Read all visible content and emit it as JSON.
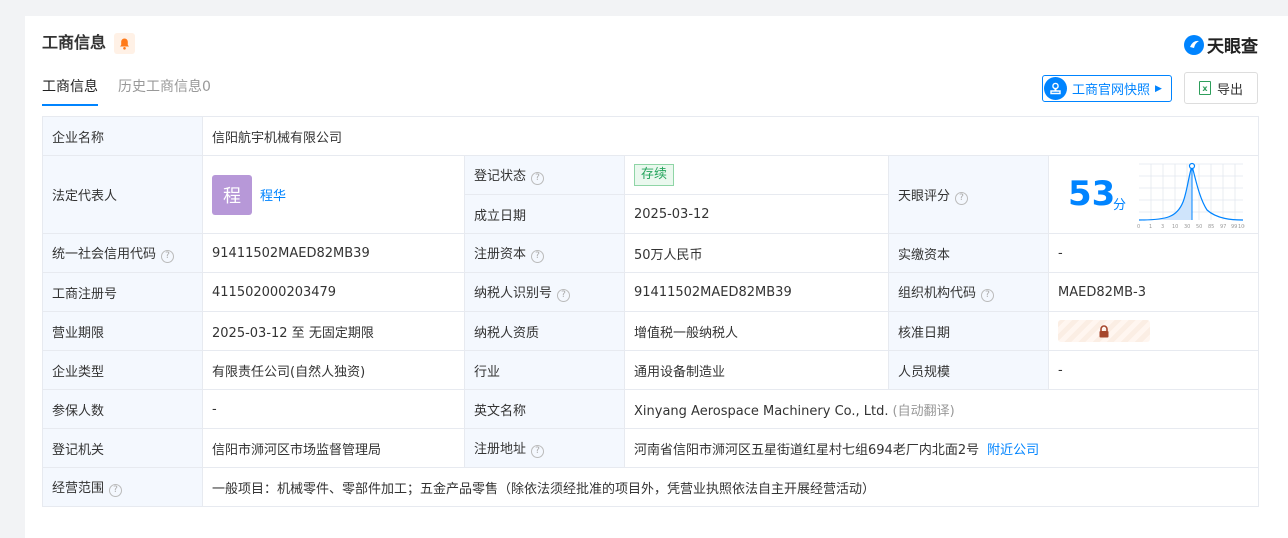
{
  "header": {
    "title": "工商信息",
    "brand": "天眼查"
  },
  "tabs": [
    {
      "label": "工商信息",
      "active": true
    },
    {
      "label": "历史工商信息0",
      "active": false
    }
  ],
  "toolbar": {
    "snapshot_label": "工商官网快照",
    "export_label": "导出"
  },
  "company": {
    "name_label": "企业名称",
    "name": "信阳航宇机械有限公司",
    "legal_rep_label": "法定代表人",
    "legal_rep_avatar": "程",
    "legal_rep": "程华",
    "reg_status_label": "登记状态",
    "reg_status": "存续",
    "founded_label": "成立日期",
    "founded": "2025-03-12",
    "tianyan_score_label": "天眼评分",
    "tianyan_score": "53",
    "score_unit": "分",
    "score_chart_ticks": [
      "0",
      "1",
      "3",
      "10",
      "30",
      "50",
      "85",
      "97",
      "99",
      "100"
    ],
    "credit_code_label": "统一社会信用代码",
    "credit_code": "91411502MAED82MB39",
    "reg_capital_label": "注册资本",
    "reg_capital": "50万人民币",
    "paid_capital_label": "实缴资本",
    "paid_capital": "-",
    "reg_no_label": "工商注册号",
    "reg_no": "411502000203479",
    "taxpayer_id_label": "纳税人识别号",
    "taxpayer_id": "91411502MAED82MB39",
    "org_code_label": "组织机构代码",
    "org_code": "MAED82MB-3",
    "term_label": "营业期限",
    "term": "2025-03-12 至 无固定期限",
    "taxpayer_qual_label": "纳税人资质",
    "taxpayer_qual": "增值税一般纳税人",
    "approval_date_label": "核准日期",
    "type_label": "企业类型",
    "type": "有限责任公司(自然人独资)",
    "industry_label": "行业",
    "industry": "通用设备制造业",
    "staff_size_label": "人员规模",
    "staff_size": "-",
    "insured_label": "参保人数",
    "insured": "-",
    "english_name_label": "英文名称",
    "english_name": "Xinyang Aerospace Machinery Co., Ltd.",
    "auto_translate": "(自动翻译)",
    "authority_label": "登记机关",
    "authority": "信阳市浉河区市场监督管理局",
    "address_label": "注册地址",
    "address": "河南省信阳市浉河区五星街道红星村七组694老厂内北面2号",
    "nearby_link": "附近公司",
    "scope_label": "经营范围",
    "scope": "一般项目：机械零件、零部件加工；五金产品零售（除依法须经批准的项目外，凭营业执照依法自主开展经营活动）"
  },
  "colors": {
    "accent": "#0084ff",
    "label_bg": "#f4f8fe",
    "status_green": "#26a45d"
  }
}
